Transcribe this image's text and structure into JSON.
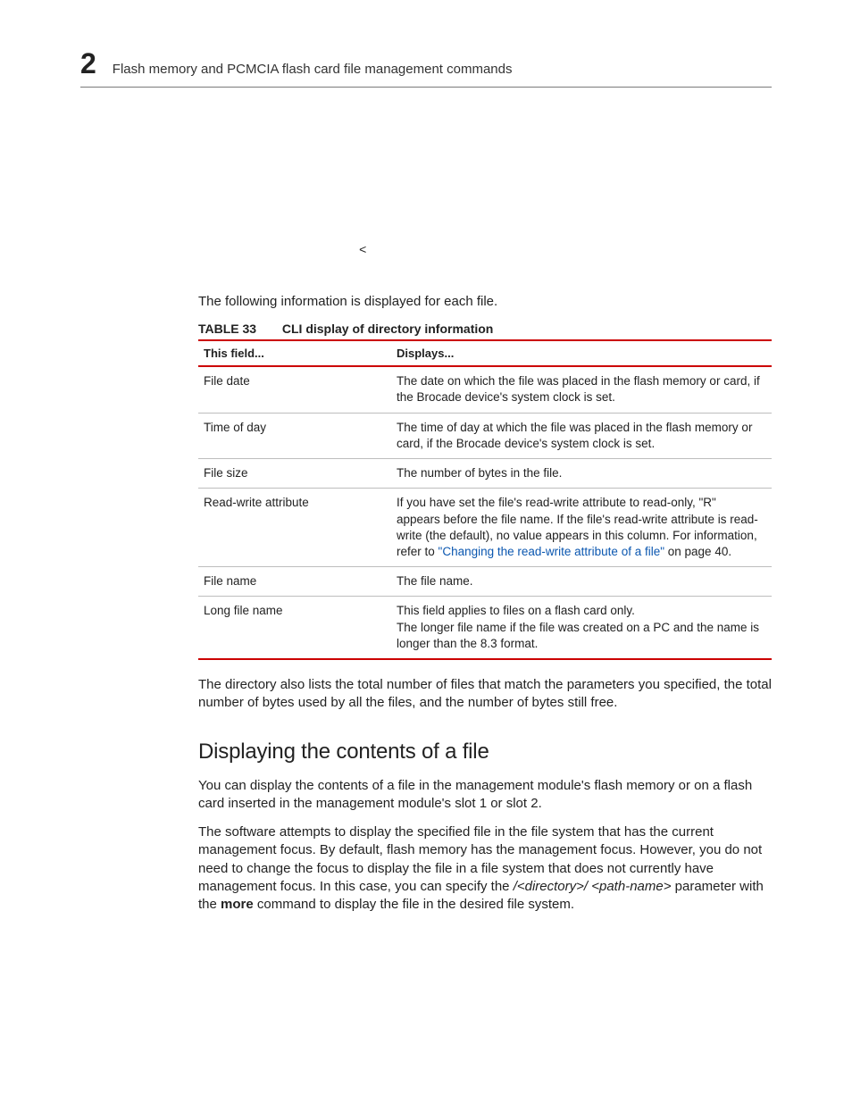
{
  "header": {
    "chapter_number": "2",
    "title": "Flash memory and PCMCIA flash card file management commands"
  },
  "stray_char": "<",
  "intro_para": "The following information is displayed for each file.",
  "table": {
    "label": "TABLE 33",
    "title": "CLI display of directory information",
    "head": {
      "c1": "This field...",
      "c2": "Displays..."
    },
    "rows": [
      {
        "field": "File date",
        "desc": "The date on which the file was placed in the flash memory or card, if the Brocade device's system clock is set."
      },
      {
        "field": "Time of day",
        "desc": "The time of day at which the file was placed in the flash memory or card, if the Brocade device's system clock is set."
      },
      {
        "field": "File size",
        "desc": "The number of bytes in the file."
      },
      {
        "field": "Read-write attribute",
        "desc_pre": "If you have set the file's read-write attribute to read-only, \"R\" appears before the file name. If the file's read-write attribute is read-write (the default), no value appears in this column. For information, refer to ",
        "desc_link": "\"Changing the read-write attribute of a file\"",
        "desc_post": " on page 40."
      },
      {
        "field": "File name",
        "desc": "The file name."
      },
      {
        "field": "Long file name",
        "desc_line1": "This field applies to files on a flash card only.",
        "desc_line2": "The longer file name if the file was created on a PC and the name is longer than the 8.3 format."
      }
    ]
  },
  "after_table_para": "The directory also lists the total number of files that match the parameters you specified, the total number of bytes used by all the files, and the number of bytes still free.",
  "section": {
    "heading": "Displaying the contents of a file",
    "p1": "You can display the contents of a file in the management module's flash memory or on a flash card inserted in the management module's slot 1 or slot 2.",
    "p2_pre": "The software attempts to display the specified file in the file system that has the current management focus. By default, flash memory has the management focus. However, you do not need to change the focus to display the file in a file system that does not currently have management focus. In this case, you can specify the ",
    "p2_ital": "/<directory>/ <path-name>",
    "p2_mid": " parameter with the ",
    "p2_bold": "more",
    "p2_post": " command to display the file in the desired file system."
  }
}
